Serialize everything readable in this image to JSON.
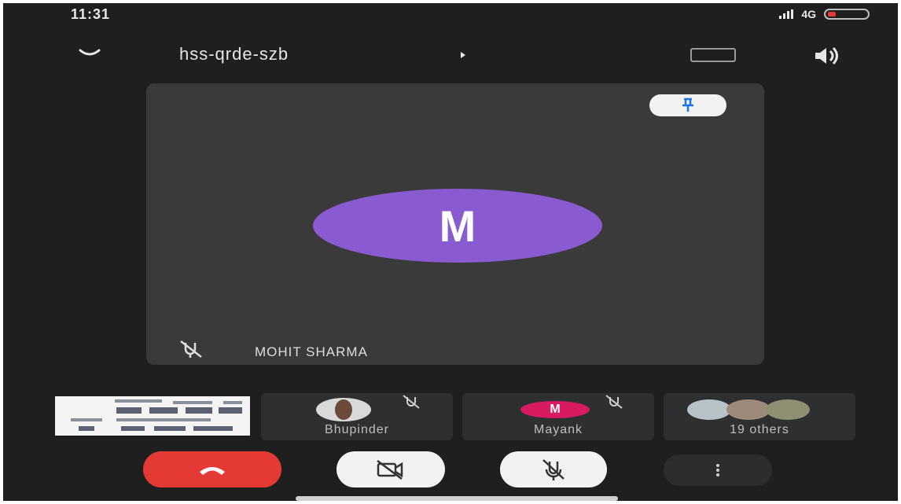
{
  "status_bar": {
    "time": "11:31",
    "network": "4G",
    "battery_level": 0.15
  },
  "header": {
    "meeting_code": "hss-qrde-szb"
  },
  "main_tile": {
    "avatar_letter": "M",
    "name": "MOHIT SHARMA"
  },
  "participants": [
    {
      "name": "Bhupinder"
    },
    {
      "name": "Mayank",
      "avatar_letter": "M"
    },
    {
      "name": "19 others"
    }
  ],
  "icons": {
    "collapse": "chevron-down-icon",
    "switch_camera": "switch-camera-icon",
    "speaker": "speaker-icon",
    "pin": "pin-icon",
    "mic_muted": "mic-off-icon",
    "end_call": "end-call-icon",
    "camera_off": "camera-off-icon",
    "more": "more-options-icon"
  },
  "colors": {
    "background": "#1f1f20",
    "tile": "#3a3a3b",
    "avatar_main": "#8a5ad0",
    "avatar_mayank": "#d81b60",
    "end_call": "#e53935",
    "control_light": "#f2f2f2"
  }
}
